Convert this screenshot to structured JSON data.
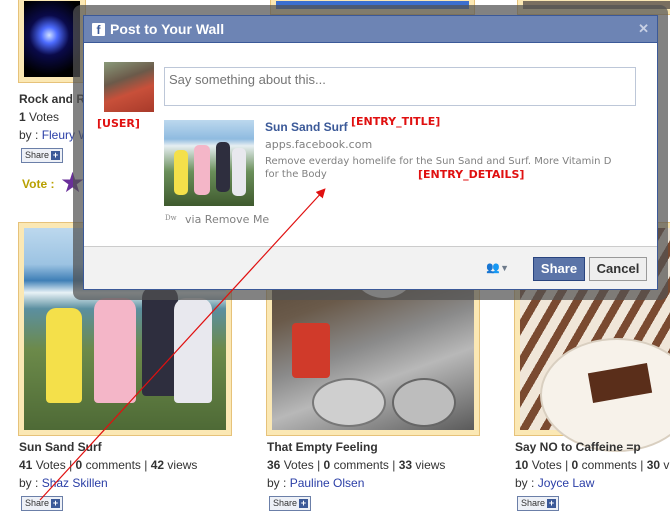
{
  "dialog": {
    "title": "Post to Your Wall",
    "placeholder": "Say something about this...",
    "attachment_title": "Sun Sand Surf",
    "attachment_domain": "apps.facebook.com",
    "attachment_desc": "Remove everday homelife for the Sun Sand and Surf. More Vitamin D for the Body",
    "via_label": "via Remove Me",
    "share_label": "Share",
    "cancel_label": "Cancel"
  },
  "annotations": {
    "user": "[USER]",
    "entry_title": "[ENTRY_TITLE]",
    "entry_details": "[ENTRY_DETAILS]"
  },
  "gallery": {
    "top_left": {
      "title": "Rock and R",
      "votes": "1",
      "votes_label": "Votes",
      "by_label": "by :",
      "author": "Fleury W",
      "share": "Share",
      "vote_label": "Vote :"
    },
    "entries": [
      {
        "title": "Sun Sand Surf",
        "votes": "41",
        "votes_label": "Votes",
        "comments": "0",
        "comments_label": "comments",
        "views": "42",
        "views_label": "views",
        "by_label": "by :",
        "author": "Shaz Skillen",
        "share": "Share"
      },
      {
        "title": "That Empty Feeling",
        "votes": "36",
        "votes_label": "Votes",
        "comments": "0",
        "comments_label": "comments",
        "views": "33",
        "views_label": "views",
        "by_label": "by :",
        "author": "Pauline Olsen",
        "share": "Share"
      },
      {
        "title": "Say NO to Caffeine =p",
        "votes": "10",
        "votes_label": "Votes",
        "comments": "0",
        "comments_label": "comments",
        "views": "30",
        "views_label": "v",
        "by_label": "by :",
        "author": "Joyce Law",
        "share": "Share"
      }
    ]
  },
  "colors": {
    "facebook_blue": "#3b5998",
    "annotation_red": "#e01010",
    "link_blue": "#2a3ea6"
  }
}
